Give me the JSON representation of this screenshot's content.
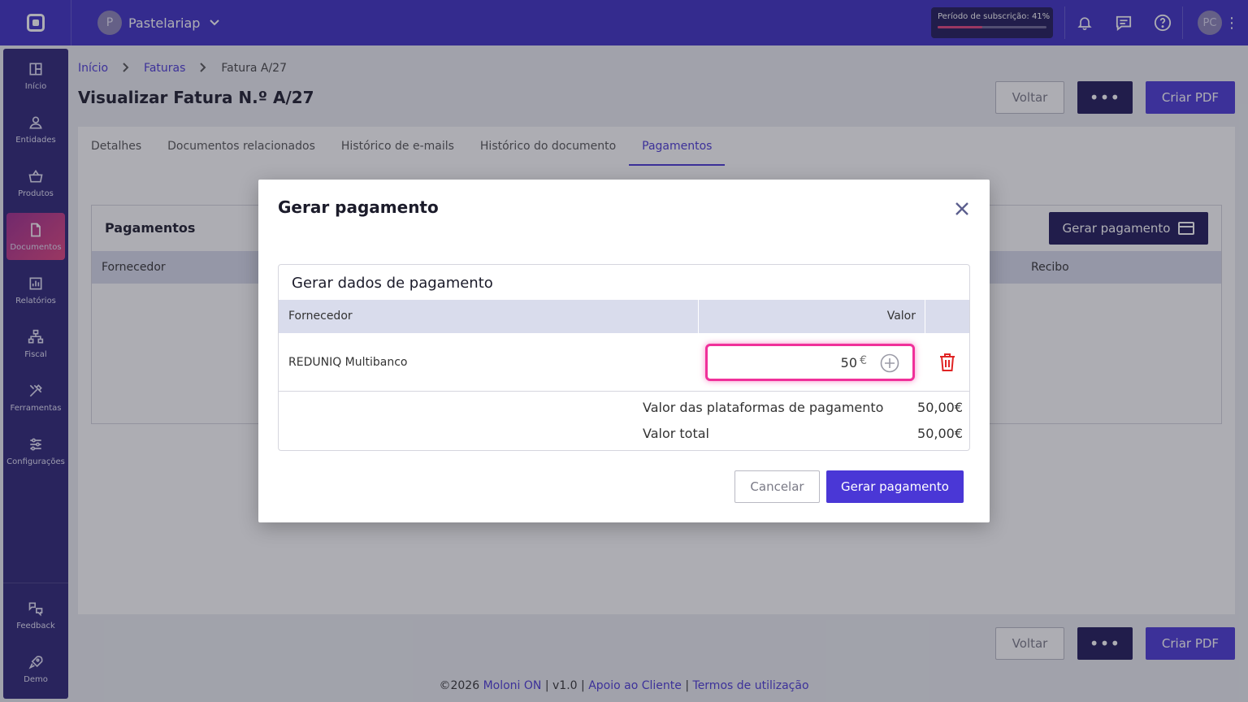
{
  "topbar": {
    "company_initial": "P",
    "company_name": "Pastelariap",
    "subscription_label": "Período de subscrição: 41%",
    "subscription_progress_pct": 41,
    "user_initials": "PC"
  },
  "sidebar": {
    "items": [
      {
        "label": "Início",
        "icon": "grid-icon"
      },
      {
        "label": "Entidades",
        "icon": "person-icon"
      },
      {
        "label": "Produtos",
        "icon": "basket-icon"
      },
      {
        "label": "Documentos",
        "icon": "document-icon",
        "active": true
      },
      {
        "label": "Relatórios",
        "icon": "chart-icon"
      },
      {
        "label": "Fiscal",
        "icon": "hierarchy-icon"
      },
      {
        "label": "Ferramentas",
        "icon": "tools-icon"
      },
      {
        "label": "Configurações",
        "icon": "sliders-icon"
      }
    ],
    "bottom": [
      {
        "label": "Feedback",
        "icon": "feedback-icon"
      },
      {
        "label": "Demo",
        "icon": "rocket-icon"
      }
    ]
  },
  "breadcrumb": {
    "home": "Início",
    "section": "Faturas",
    "current": "Fatura A/27"
  },
  "page": {
    "title": "Visualizar Fatura N.º A/27",
    "back_label": "Voltar",
    "more_label": "•••",
    "pdf_label": "Criar PDF"
  },
  "tabs": [
    {
      "label": "Detalhes"
    },
    {
      "label": "Documentos relacionados"
    },
    {
      "label": "Histórico de e-mails"
    },
    {
      "label": "Histórico do documento"
    },
    {
      "label": "Pagamentos",
      "active": true
    }
  ],
  "payments_panel": {
    "title": "Pagamentos",
    "generate_label": "Gerar pagamento",
    "col_supplier": "Fornecedor",
    "col_receipt": "Recibo"
  },
  "modal": {
    "title": "Gerar pagamento",
    "section_title": "Gerar dados de pagamento",
    "col_supplier": "Fornecedor",
    "col_value": "Valor",
    "row": {
      "supplier": "REDUNIQ Multibanco",
      "value": "50",
      "currency": "€"
    },
    "platforms_label": "Valor das plataformas de pagamento",
    "platforms_value": "50,00€",
    "total_label": "Valor total",
    "total_value": "50,00€",
    "cancel_label": "Cancelar",
    "submit_label": "Gerar pagamento"
  },
  "footer": {
    "copyright": "©2026",
    "brand": "Moloni ON",
    "version": "v1.0",
    "support": "Apoio ao Cliente",
    "terms": "Termos de utilização",
    "sep": "|"
  },
  "colors": {
    "primary": "#4a37d6",
    "topbar": "#3d2ec3",
    "sidebar": "#2a2275",
    "dark_button": "#1e1857",
    "highlight": "#f0309a",
    "danger": "#e02424"
  }
}
